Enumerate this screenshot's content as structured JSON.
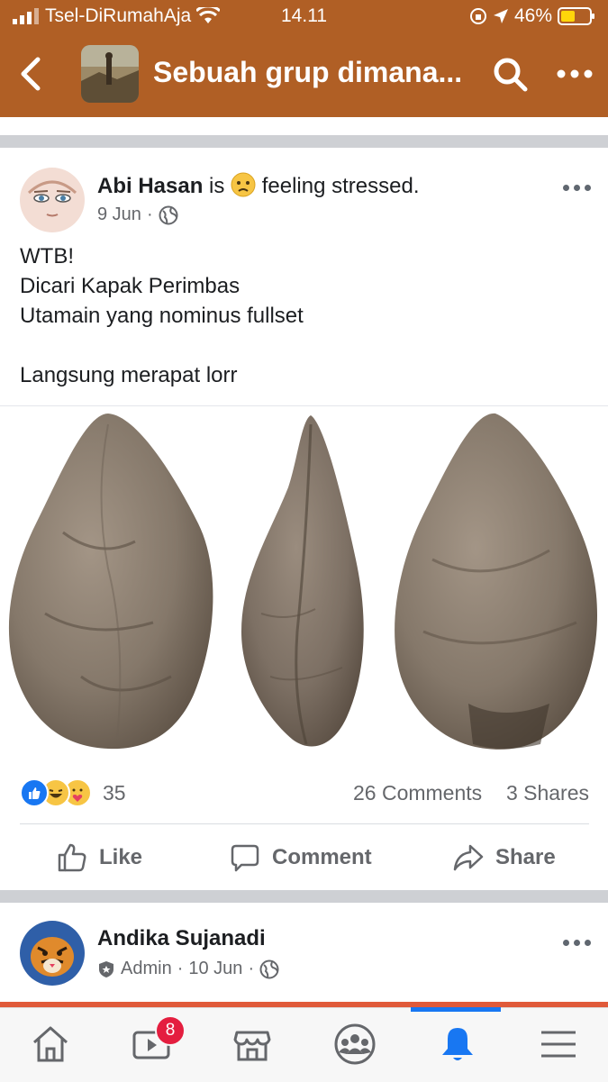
{
  "status_bar": {
    "carrier": "Tsel-DiRumahAja",
    "time": "14.11",
    "battery": "46%"
  },
  "nav": {
    "title": "Sebuah grup dimana..."
  },
  "post": {
    "author": "Abi Hasan",
    "feeling_prefix": "is",
    "feeling": "feeling stressed.",
    "date": "9 Jun",
    "separator": "·",
    "lines": [
      "WTB!",
      "Dicari Kapak Perimbas",
      "Utamain yang nominus fullset",
      "",
      "Langsung merapat lorr"
    ],
    "reaction_count": "35",
    "comments": "26 Comments",
    "shares": "3 Shares",
    "actions": {
      "like": "Like",
      "comment": "Comment",
      "share": "Share"
    }
  },
  "next_post": {
    "author": "Andika Sujanadi",
    "role": "Admin",
    "date": "10 Jun",
    "separator": "·"
  },
  "tabbar": {
    "video_badge": "8"
  },
  "colors": {
    "header": "#b05f25",
    "facebook_blue": "#1877f2",
    "badge_red": "#e41e3f"
  }
}
